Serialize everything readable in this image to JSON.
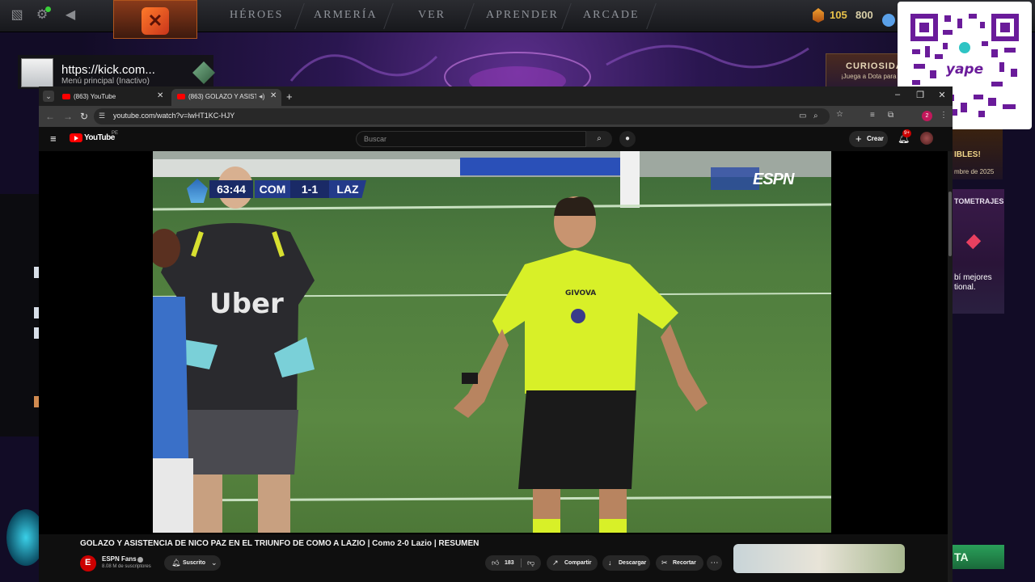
{
  "dota": {
    "nav": [
      "HÉROES",
      "ARMERÍA",
      "VER",
      "APRENDER",
      "ARCADE"
    ],
    "currency_a": "105",
    "currency_b": "800",
    "curiosidades_title": "CURIOSIDA",
    "curiosidades_text": "¡Juega a Dota para de",
    "panel_bibles_title": "IBLES!",
    "panel_bibles_date": "mbre de 2025",
    "panel_corto_title": "TOMETRAJES",
    "panel_corto_text1": "bí mejores",
    "panel_corto_text2": "tional.",
    "panel_jugar": "TA"
  },
  "kick": {
    "url": "https://kick.com...",
    "subtitle": "Menú principal (Inactivo)"
  },
  "qr": {
    "brand": "yape"
  },
  "browser": {
    "tabs": [
      {
        "label": "(863) YouTube"
      },
      {
        "label": "(863) GOLAZO Y ASISTENCIA"
      }
    ],
    "url": "youtube.com/watch?v=lwHT1KC-HJY"
  },
  "youtube": {
    "wordmark": "YouTube",
    "country": "PE",
    "search_placeholder": "Buscar",
    "create_label": "Crear",
    "notif_count": "9+",
    "video_title": "GOLAZO Y ASISTENCIA DE NICO PAZ EN EL TRIUNFO DE COMO A LAZIO | Como 2-0 Lazio | RESUMEN",
    "channel_name": "ESPN Fans",
    "channel_subs": "8.08 M de suscriptores",
    "subscribed_label": "Suscrito",
    "likes": "183",
    "share_label": "Compartir",
    "download_label": "Descargar",
    "clip_label": "Recortar"
  },
  "scorebug": {
    "time": "63:44",
    "home": "COM",
    "score": "1-1",
    "away": "LAZ",
    "broadcaster": "ESPN"
  }
}
